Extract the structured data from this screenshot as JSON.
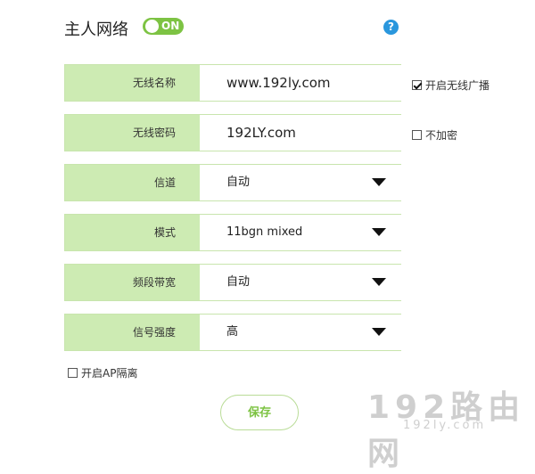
{
  "header": {
    "title": "主人网络",
    "toggle_label": "ON"
  },
  "help_label": "?",
  "rows": [
    {
      "label": "无线名称",
      "value": "www.192ly.com"
    },
    {
      "label": "无线密码",
      "value": "192LY.com"
    },
    {
      "label": "信道",
      "value": "自动"
    },
    {
      "label": "模式",
      "value": "11bgn mixed"
    },
    {
      "label": "频段带宽",
      "value": "自动"
    },
    {
      "label": "信号强度",
      "value": "高"
    }
  ],
  "options": {
    "broadcast_label": "开启无线广播",
    "broadcast_checked": true,
    "no_encrypt_label": "不加密",
    "no_encrypt_checked": false,
    "ap_isolation_label": "开启AP隔离",
    "ap_isolation_checked": false
  },
  "save_label": "保存",
  "watermark": {
    "main": "192路由网",
    "sub": "192ly.com"
  },
  "colors": {
    "accent": "#7dc343",
    "label_bg": "#cdebb3",
    "help": "#2a97dd"
  }
}
